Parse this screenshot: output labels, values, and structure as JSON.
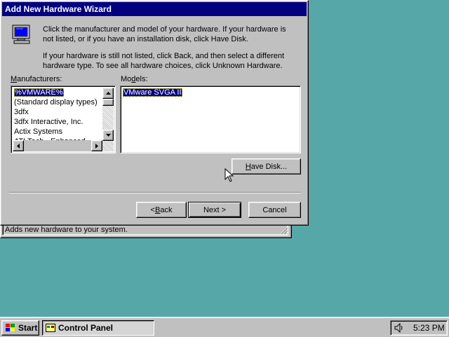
{
  "control_panel": {
    "status_text": "Adds new hardware to your system."
  },
  "wizard": {
    "title": "Add New Hardware Wizard",
    "intro_line1": "Click the manufacturer and model of your hardware. If your hardware is not listed, or if you have an installation disk, click Have Disk.",
    "intro_line2": "If your hardware is still not listed, click Back, and then select a different hardware type. To see all hardware choices, click Unknown Hardware.",
    "manufacturers_label_u": "M",
    "manufacturers_label_rest": "anufacturers:",
    "models_label_pre": "Mo",
    "models_label_u": "d",
    "models_label_rest": "els:",
    "manufacturers": [
      "%VMWARE%",
      "(Standard display types)",
      "3dfx",
      "3dfx Interactive, Inc.",
      "Actix Systems",
      "ATI Tech - Enhanced"
    ],
    "selected_manufacturer": "%VMWARE%",
    "models": [
      "VMware SVGA II"
    ],
    "selected_model": "VMware SVGA II",
    "have_disk_u": "H",
    "have_disk_rest": "ave Disk...",
    "back_pre": "< ",
    "back_u": "B",
    "back_rest": "ack",
    "next_label": "Next >",
    "cancel_label": "Cancel"
  },
  "taskbar": {
    "start_label": "Start",
    "task_label": "Control Panel",
    "clock": "5:23 PM"
  },
  "colors": {
    "desktop": "#56a7a8",
    "titlebar": "#000080",
    "face": "#c0c0c0",
    "selection": "#000080"
  },
  "icons": [
    "monitor-icon",
    "windows-logo-icon",
    "control-panel-icon",
    "volume-icon",
    "arrow-cursor-icon"
  ]
}
